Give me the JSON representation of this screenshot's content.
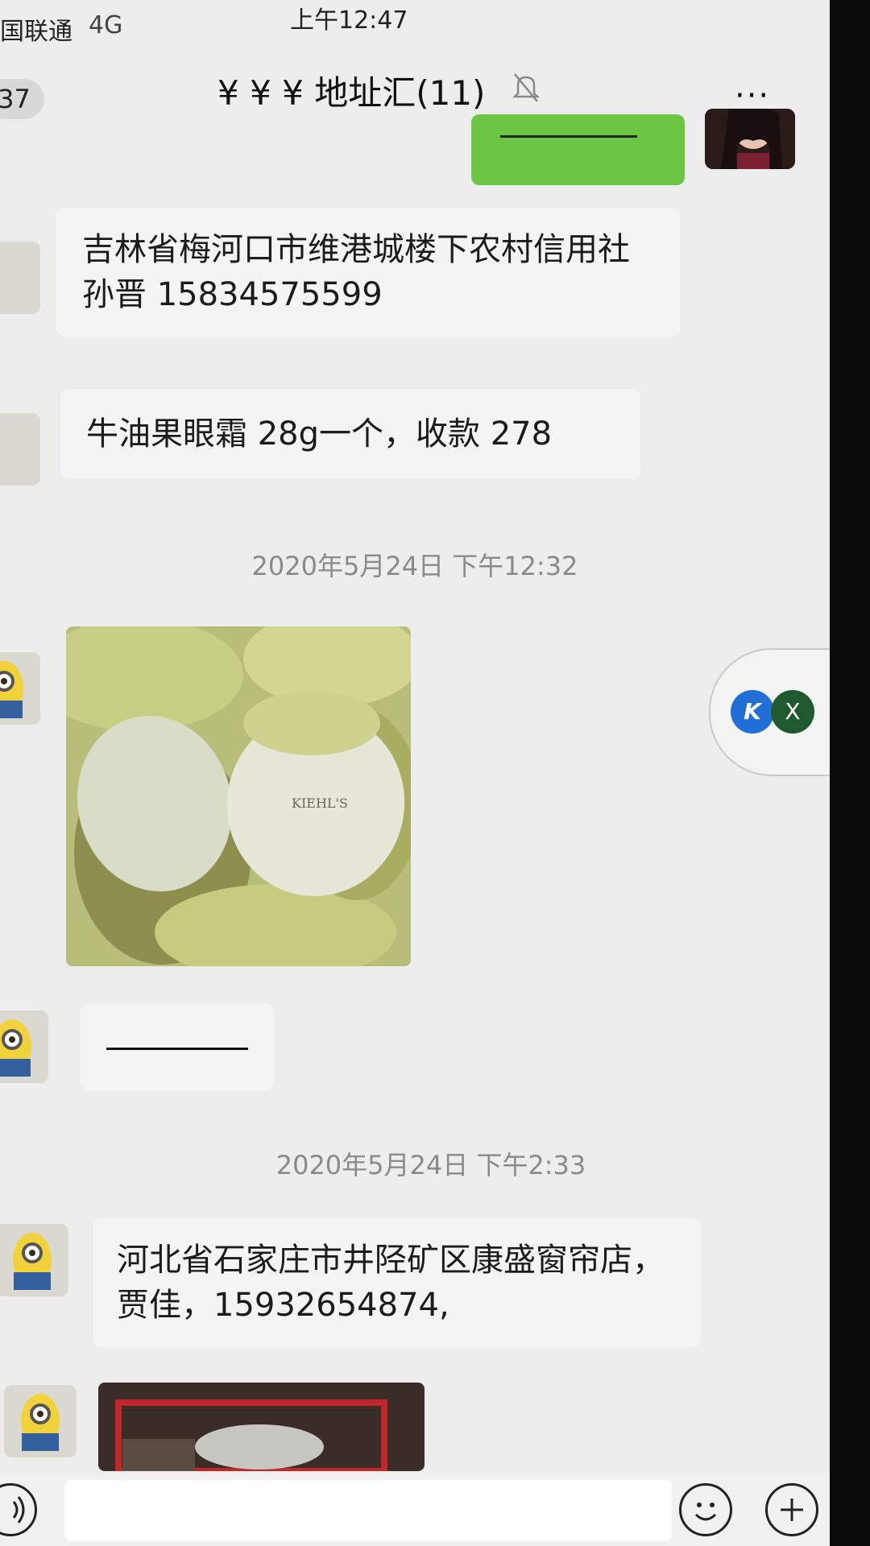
{
  "status_bar": {
    "carrier": "国联通",
    "network": "4G",
    "time": "上午12:47"
  },
  "nav": {
    "back_count": "37",
    "title": "¥ ¥ ¥ 地址汇(11)",
    "more_label": "···"
  },
  "messages": [
    {
      "type": "text",
      "sender": "self",
      "text": ""
    },
    {
      "type": "text",
      "sender": "other",
      "text": "吉林省梅河口市维港城楼下农村信用社 孙晋 15834575599"
    },
    {
      "type": "text",
      "sender": "other",
      "text": "牛油果眼霜 28g一个，收款 278"
    },
    {
      "type": "timestamp",
      "text": "2020年5月24日 下午12:32"
    },
    {
      "type": "image",
      "sender": "other",
      "label": "KIEHL'S"
    },
    {
      "type": "text",
      "sender": "other",
      "text": ""
    },
    {
      "type": "timestamp",
      "text": "2020年5月24日 下午2:33"
    },
    {
      "type": "text",
      "sender": "other",
      "text": "河北省石家庄市井陉矿区康盛窗帘店，贾佳，15932654874,"
    },
    {
      "type": "image",
      "sender": "other",
      "label": ""
    }
  ],
  "floating_widget": {
    "k_label": "K",
    "x_label": "X"
  },
  "colors": {
    "self_bubble": "#6cc644",
    "other_bubble": "#f4f4f2",
    "background": "#ededed",
    "timestamp": "#8a8a8a"
  },
  "input_bar": {
    "voice_icon": "voice-icon",
    "emoji_icon": "emoji-icon",
    "plus_icon": "plus-icon"
  }
}
